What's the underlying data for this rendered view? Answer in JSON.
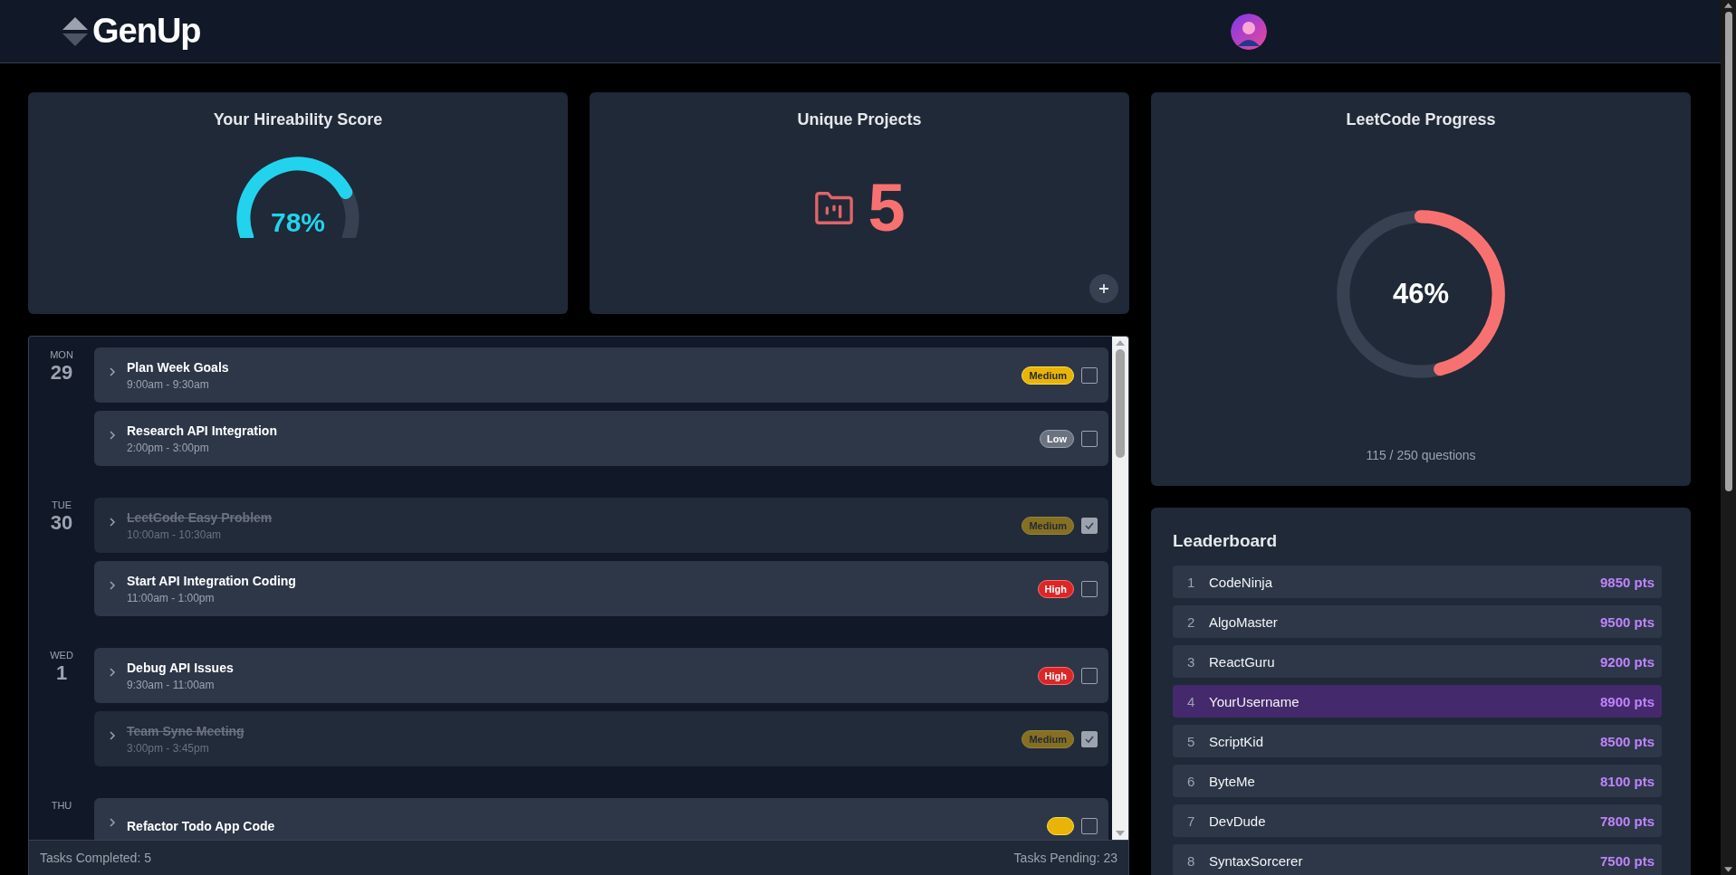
{
  "header": {
    "brand": "GenUp"
  },
  "hireability": {
    "title": "Your Hireability Score",
    "value": "78%"
  },
  "projects": {
    "title": "Unique Projects",
    "count": "5"
  },
  "task_days": [
    {
      "weekday": "MON",
      "date": "29",
      "tasks": [
        {
          "title": "Plan Week Goals",
          "time": "9:00am - 9:30am",
          "kind": "medium",
          "label": "Medium",
          "checked": false
        },
        {
          "title": "Research API Integration",
          "time": "2:00pm - 3:00pm",
          "kind": "low",
          "label": "Low",
          "checked": false
        }
      ]
    },
    {
      "weekday": "TUE",
      "date": "30",
      "tasks": [
        {
          "title": "LeetCode Easy Problem",
          "time": "10:00am - 10:30am",
          "kind": "medium",
          "label": "Medium",
          "checked": true
        },
        {
          "title": "Start API Integration Coding",
          "time": "11:00am - 1:00pm",
          "kind": "high",
          "label": "High",
          "checked": false
        }
      ]
    },
    {
      "weekday": "WED",
      "date": "1",
      "tasks": [
        {
          "title": "Debug API Issues",
          "time": "9:30am - 11:00am",
          "kind": "high",
          "label": "High",
          "checked": false
        },
        {
          "title": "Team Sync Meeting",
          "time": "3:00pm - 3:45pm",
          "kind": "medium",
          "label": "Medium",
          "checked": true
        }
      ]
    },
    {
      "weekday": "THU",
      "tasks": [
        {
          "title": "Refactor Todo App Code",
          "kind": "medium",
          "checked": false
        }
      ]
    }
  ],
  "task_footer": {
    "completed": "Tasks Completed: 5",
    "pending": "Tasks Pending: 23"
  },
  "leetcode": {
    "title": "LeetCode Progress",
    "value": "46%",
    "level": 0.46,
    "caption": "115 / 250 questions"
  },
  "leaderboard": {
    "title": "Leaderboard",
    "rows": [
      {
        "rank": "1",
        "name": "CodeNinja",
        "points": "9850 pts",
        "selected": false
      },
      {
        "rank": "2",
        "name": "AlgoMaster",
        "points": "9500 pts",
        "selected": false
      },
      {
        "rank": "3",
        "name": "ReactGuru",
        "points": "9200 pts",
        "selected": false
      },
      {
        "rank": "4",
        "name": "YourUsername",
        "points": "8900 pts",
        "selected": true
      },
      {
        "rank": "5",
        "name": "ScriptKid",
        "points": "8500 pts",
        "selected": false
      },
      {
        "rank": "6",
        "name": "ByteMe",
        "points": "8100 pts",
        "selected": false
      },
      {
        "rank": "7",
        "name": "DevDude",
        "points": "7800 pts",
        "selected": false
      },
      {
        "rank": "8",
        "name": "SyntaxSorcerer",
        "points": "7500 pts",
        "selected": false
      }
    ]
  }
}
